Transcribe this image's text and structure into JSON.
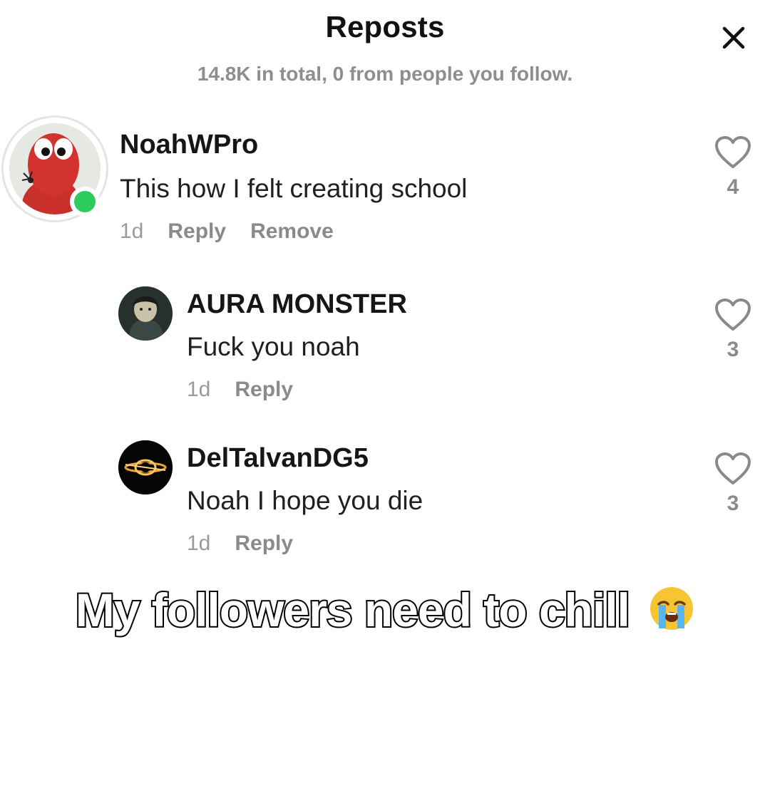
{
  "sheet": {
    "title": "Reposts",
    "subtitle": "14.8K in total, 0 from people you follow."
  },
  "comments": [
    {
      "username": "NoahWPro",
      "text": "This how I felt creating school",
      "time": "1d",
      "reply_label": "Reply",
      "remove_label": "Remove",
      "likes": "4",
      "online": true
    },
    {
      "username": "AURA MONSTER",
      "text": "Fuck you noah",
      "time": "1d",
      "reply_label": "Reply",
      "likes": "3"
    },
    {
      "username": "DelTalvanDG5",
      "text": "Noah I hope you die",
      "time": "1d",
      "reply_label": "Reply",
      "likes": "3"
    }
  ],
  "caption": {
    "text": "My followers need to chill",
    "emoji": "loudly-crying-face"
  },
  "colors": {
    "online": "#2ccd5c",
    "muted_text": "#8a8a8a"
  }
}
